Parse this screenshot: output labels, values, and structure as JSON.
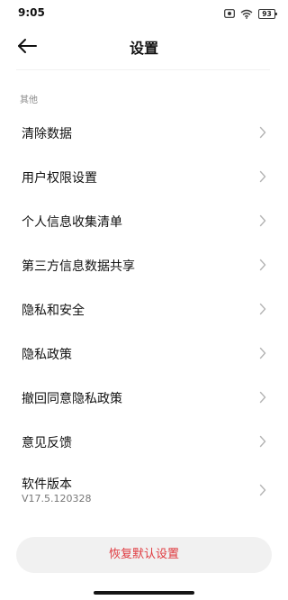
{
  "status_bar": {
    "time": "9:05",
    "battery": "93",
    "icons": [
      "wifi-icon",
      "screen-record-icon",
      "battery-icon"
    ]
  },
  "header": {
    "title": "设置",
    "back_icon": "back-arrow-icon"
  },
  "section": {
    "label": "其他"
  },
  "menu": {
    "items": [
      {
        "label": "清除数据"
      },
      {
        "label": "用户权限设置"
      },
      {
        "label": "个人信息收集清单"
      },
      {
        "label": "第三方信息数据共享"
      },
      {
        "label": "隐私和安全"
      },
      {
        "label": "隐私政策"
      },
      {
        "label": "撤回同意隐私政策"
      },
      {
        "label": "意见反馈"
      },
      {
        "label": "软件版本",
        "sub": "V17.5.120328"
      }
    ]
  },
  "footer": {
    "reset_label": "恢复默认设置"
  },
  "colors": {
    "accent_red": "#e0393f",
    "button_bg": "#f1f1f1",
    "chevron": "#b5b5b5"
  }
}
